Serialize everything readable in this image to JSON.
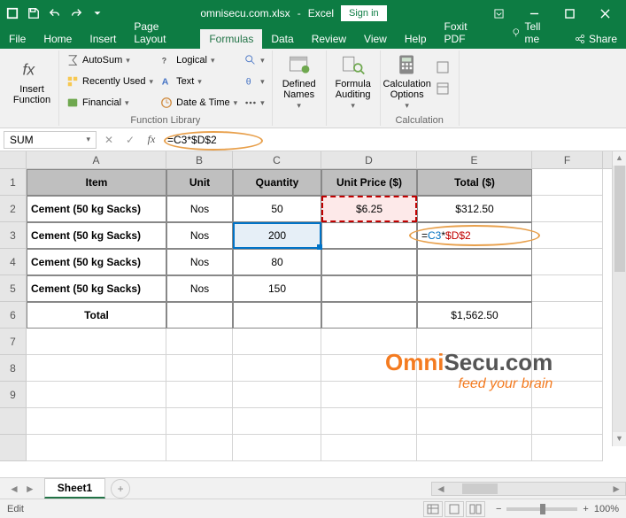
{
  "title": {
    "doc": "omnisecu.com.xlsx",
    "app": "Excel",
    "signin": "Sign in"
  },
  "tabs": [
    "File",
    "Home",
    "Insert",
    "Page Layout",
    "Formulas",
    "Data",
    "Review",
    "View",
    "Help",
    "Foxit PDF"
  ],
  "activeTab": 4,
  "tellme": "Tell me",
  "share": "Share",
  "ribbon": {
    "insertFn": "Insert\nFunction",
    "lib": {
      "autosum": "AutoSum",
      "recent": "Recently Used",
      "financial": "Financial",
      "logical": "Logical",
      "text": "Text",
      "datetime": "Date & Time",
      "label": "Function Library"
    },
    "defined": "Defined\nNames",
    "auditing": "Formula\nAuditing",
    "calc": {
      "btn": "Calculation\nOptions",
      "label": "Calculation"
    }
  },
  "namebox": "SUM",
  "formula": "=C3*$D$2",
  "cols": [
    "A",
    "B",
    "C",
    "D",
    "E",
    "F"
  ],
  "rownums": [
    "1",
    "2",
    "3",
    "4",
    "5",
    "6",
    "7",
    "8",
    "9"
  ],
  "hdr": {
    "a": "Item",
    "b": "Unit",
    "c": "Quantity",
    "d": "Unit Price ($)",
    "e": "Total ($)"
  },
  "data": [
    {
      "a": "Cement (50 kg Sacks)",
      "b": "Nos",
      "c": "50",
      "d": "$6.25",
      "e": "$312.50"
    },
    {
      "a": "Cement (50 kg Sacks)",
      "b": "Nos",
      "c": "200",
      "d": "",
      "e": "=C3*$D$2"
    },
    {
      "a": "Cement (50 kg Sacks)",
      "b": "Nos",
      "c": "80",
      "d": "",
      "e": ""
    },
    {
      "a": "Cement (50 kg Sacks)",
      "b": "Nos",
      "c": "150",
      "d": "",
      "e": ""
    }
  ],
  "total": {
    "label": "Total",
    "val": "$1,562.50"
  },
  "formula_parts": {
    "eq": "=",
    "ref1": "C3",
    "op": "*",
    "ref2": "$D$2"
  },
  "sheet": "Sheet1",
  "status": "Edit",
  "zoom": "100%",
  "logo": {
    "l1a": "Omni",
    "l1b": "Secu.com",
    "l2": "feed your brain"
  }
}
